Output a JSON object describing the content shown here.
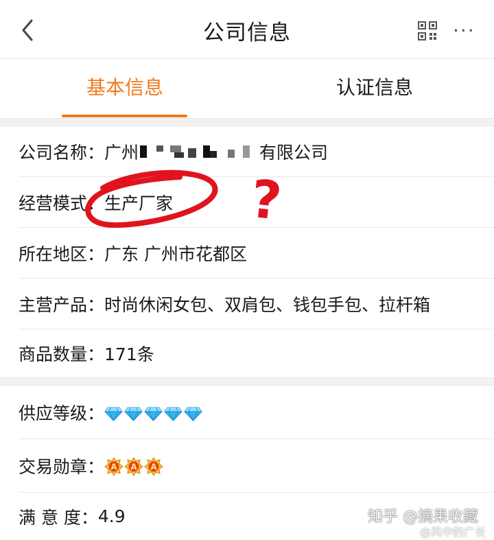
{
  "header": {
    "title": "公司信息",
    "more_label": "···"
  },
  "tabs": [
    {
      "label": "基本信息",
      "active": true
    },
    {
      "label": "认证信息",
      "active": false
    }
  ],
  "colors": {
    "accent": "#ee7a1f",
    "annotation_red": "#e0141e",
    "gem_blue": "#36b4f0"
  },
  "company": {
    "name_label": "公司名称：",
    "name_prefix": "广州",
    "name_suffix": "有限公司",
    "mode_label": "经营模式：",
    "mode_value": "生产厂家",
    "region_label": "所在地区：",
    "region_value": "广东 广州市花都区",
    "products_label": "主营产品：",
    "products_value": "时尚休闲女包、双肩包、钱包手包、拉杆箱",
    "count_label": "商品数量：",
    "count_value": "171条"
  },
  "ratings": {
    "supply_label": "供应等级：",
    "supply_level": 5,
    "supply_icon": "blue-diamond-icon",
    "medal_label": "交易勋章：",
    "medal_count": 3,
    "medal_icon": "a-medal-icon",
    "medal_text": "A",
    "satisfaction_label": "满 意 度：",
    "satisfaction_value": "4.9"
  },
  "annotation": {
    "mark": "?"
  },
  "watermark": {
    "line1": "知乎 @摘果收藏",
    "line2": "@风中的广长"
  }
}
